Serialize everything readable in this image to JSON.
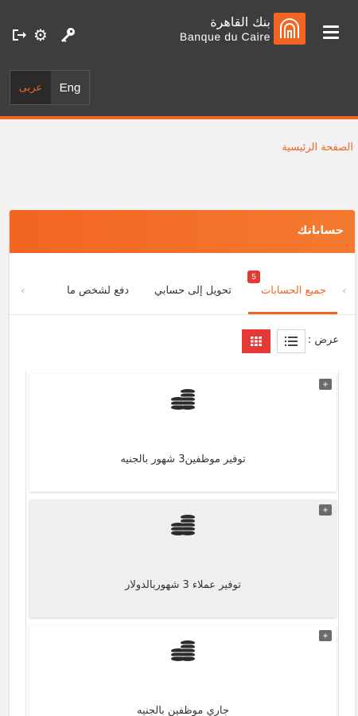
{
  "header": {
    "logo_ar": "بنك القاهرة",
    "logo_en": "Banque du Caire"
  },
  "language": {
    "arabic": "عربى",
    "english": "Eng"
  },
  "breadcrumb": "الصفحة الرئيسية",
  "panel": {
    "title": "حساباتك",
    "tabs": [
      {
        "label": "جميع الحسابات",
        "badge": "5",
        "active": true
      },
      {
        "label": "تحويل إلى حسابي",
        "active": false
      },
      {
        "label": "دفع لشخص ما",
        "active": false
      }
    ],
    "view_label": "عرض :"
  },
  "accounts": [
    {
      "name": "توفير موظفين3 شهور بالجنيه"
    },
    {
      "name": "توفير عملاء 3 شهوربالدولار"
    },
    {
      "name": "جاري موظفين بالجنيه"
    }
  ],
  "colors": {
    "accent": "#f26522",
    "header_bg": "#3d3d3d",
    "badge": "#e53935"
  },
  "icons": [
    "logout-icon",
    "gear-icon",
    "key-icon",
    "menu-icon",
    "coins-icon",
    "list-view-icon",
    "grid-view-icon",
    "plus-icon"
  ]
}
